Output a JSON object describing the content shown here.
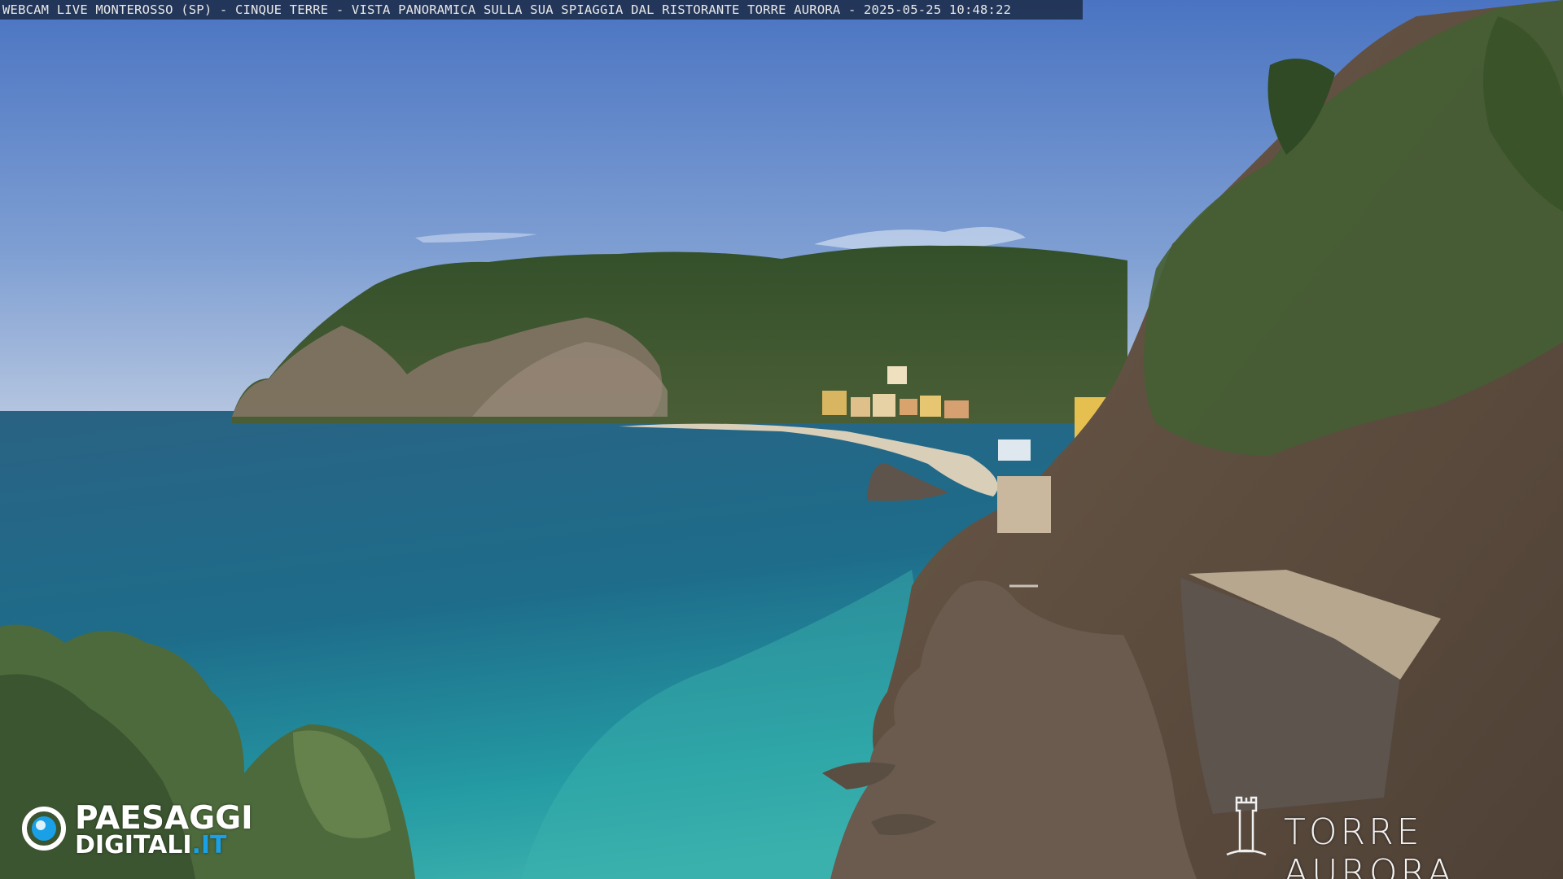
{
  "overlay": {
    "caption": "WEBCAM LIVE MONTEROSSO (SP) - CINQUE TERRE - VISTA PANORAMICA SULLA SUA SPIAGGIA DAL RISTORANTE TORRE AURORA - 2025-05-25 10:48:22"
  },
  "watermark_left": {
    "line1": "PAESAGGI",
    "line2_main": "DIGITALI",
    "line2_tld": ".IT",
    "accent": "#1aa0e6"
  },
  "watermark_right": {
    "name": "TORRE AURORA"
  },
  "palette": {
    "sky_top": "#4f79c4",
    "sky_bottom": "#a9bddc",
    "sea_deep": "#1f5a78",
    "sea_shallow": "#2ea3a8",
    "hill": "#3f5a2c",
    "rock": "#7a6a5c"
  }
}
